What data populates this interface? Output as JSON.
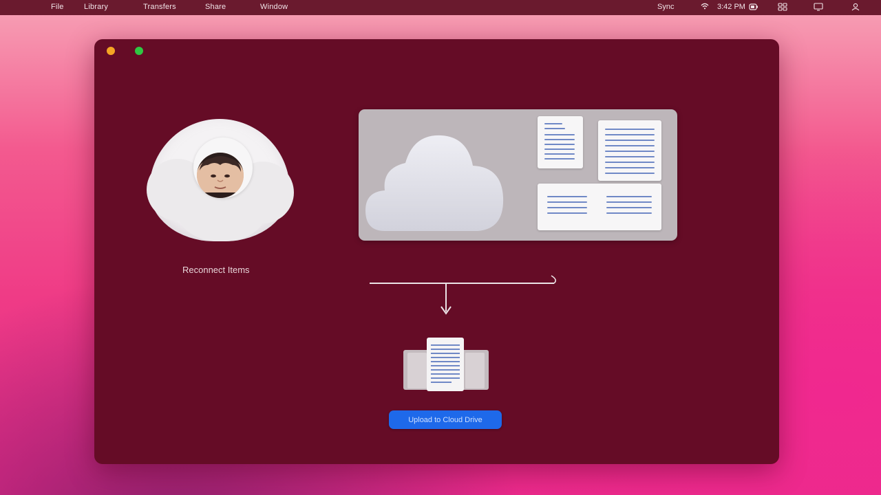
{
  "menubar": {
    "apple": "",
    "items": [
      "File",
      "Library",
      "Transfers",
      "Share",
      "Window"
    ],
    "right_items": [
      "Sync",
      "3:42 PM"
    ]
  },
  "window": {
    "profile_label": "Reconnect Items",
    "action_button": "Upload to Cloud Drive"
  },
  "colors": {
    "window_bg": "#650c26",
    "menubar_bg": "#6a1a2e",
    "accent": "#1e69ea",
    "panel_bg": "#bdb6ba",
    "doc_line": "#6f88c6"
  },
  "icons": [
    "apple-icon",
    "wifi-icon",
    "battery-icon",
    "control-center-icon",
    "user-icon"
  ]
}
